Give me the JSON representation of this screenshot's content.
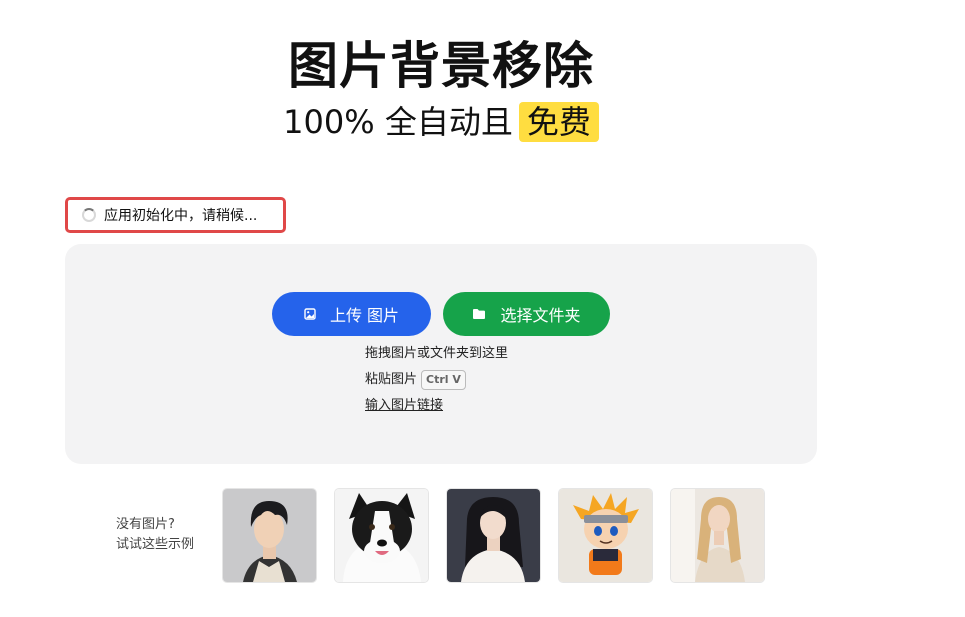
{
  "header": {
    "title": "图片背景移除",
    "subtitle": "100% 全自动且",
    "subtitle_highlight": "免费"
  },
  "status": {
    "text": "应用初始化中，请稍候..."
  },
  "upload": {
    "upload_button": "上传  图片",
    "folder_button": "选择文件夹",
    "drag_hint": "拖拽图片或文件夹到这里",
    "paste_hint": "粘贴图片",
    "paste_shortcut": "Ctrl V",
    "url_link": "输入图片链接"
  },
  "examples": {
    "line1": "没有图片?",
    "line2": "试试这些示例",
    "items": [
      "anime-man",
      "border-collie-dog",
      "young-woman",
      "naruto-figure",
      "blonde-woman"
    ]
  },
  "colors": {
    "upload_button": "#2563eb",
    "folder_button": "#16a34a",
    "highlight": "#ffdd40",
    "status_border": "#e04848"
  }
}
